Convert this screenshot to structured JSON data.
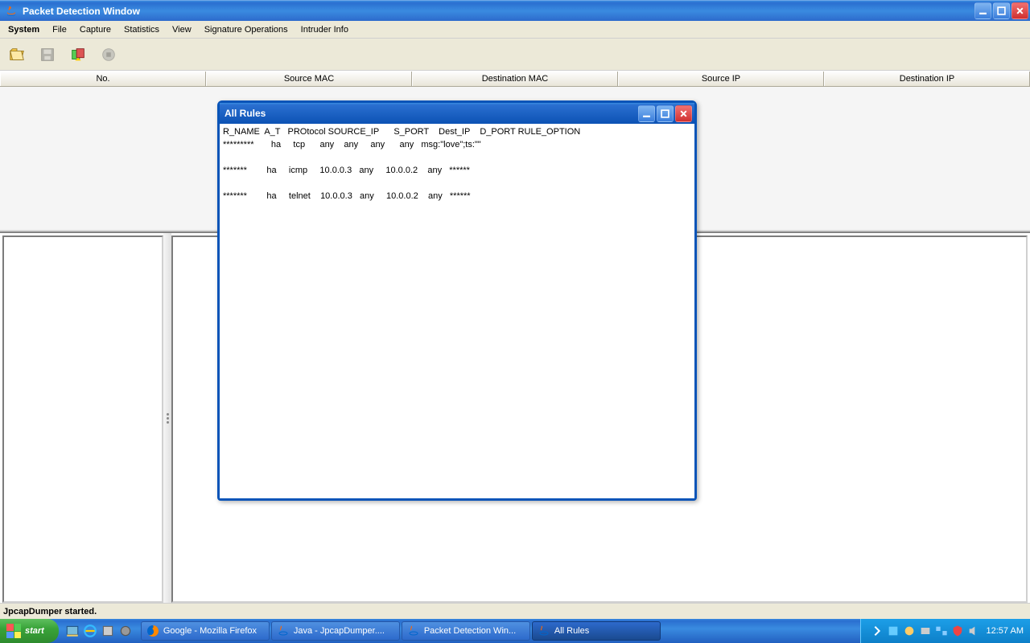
{
  "mainWindow": {
    "title": "Packet Detection Window"
  },
  "menubar": [
    "System",
    "File",
    "Capture",
    "Statistics",
    "View",
    "Signature Operations",
    "Intruder Info"
  ],
  "columns": [
    "No.",
    "Source MAC",
    "Destination MAC",
    "Source IP",
    "Destination IP"
  ],
  "status": "JpcapDumper started.",
  "dialog": {
    "title": "All Rules",
    "header": "R_NAME  A_T   PROtocol SOURCE_IP      S_PORT    Dest_IP    D_PORT RULE_OPTION",
    "rows": [
      "*********       ha     tcp      any    any     any      any   msg:\"love\";ts:\"\"",
      "",
      "*******        ha     icmp     10.0.0.3   any     10.0.0.2    any   ******",
      "",
      "*******        ha     telnet    10.0.0.3   any     10.0.0.2    any   ******"
    ]
  },
  "taskbar": {
    "start": "start",
    "tasks": [
      {
        "label": "Google - Mozilla Firefox",
        "icon": "firefox"
      },
      {
        "label": "Java - JpcapDumper....",
        "icon": "java"
      },
      {
        "label": "Packet Detection Win...",
        "icon": "java"
      },
      {
        "label": "All Rules",
        "icon": "java",
        "active": true
      }
    ],
    "clock": "12:57 AM"
  }
}
